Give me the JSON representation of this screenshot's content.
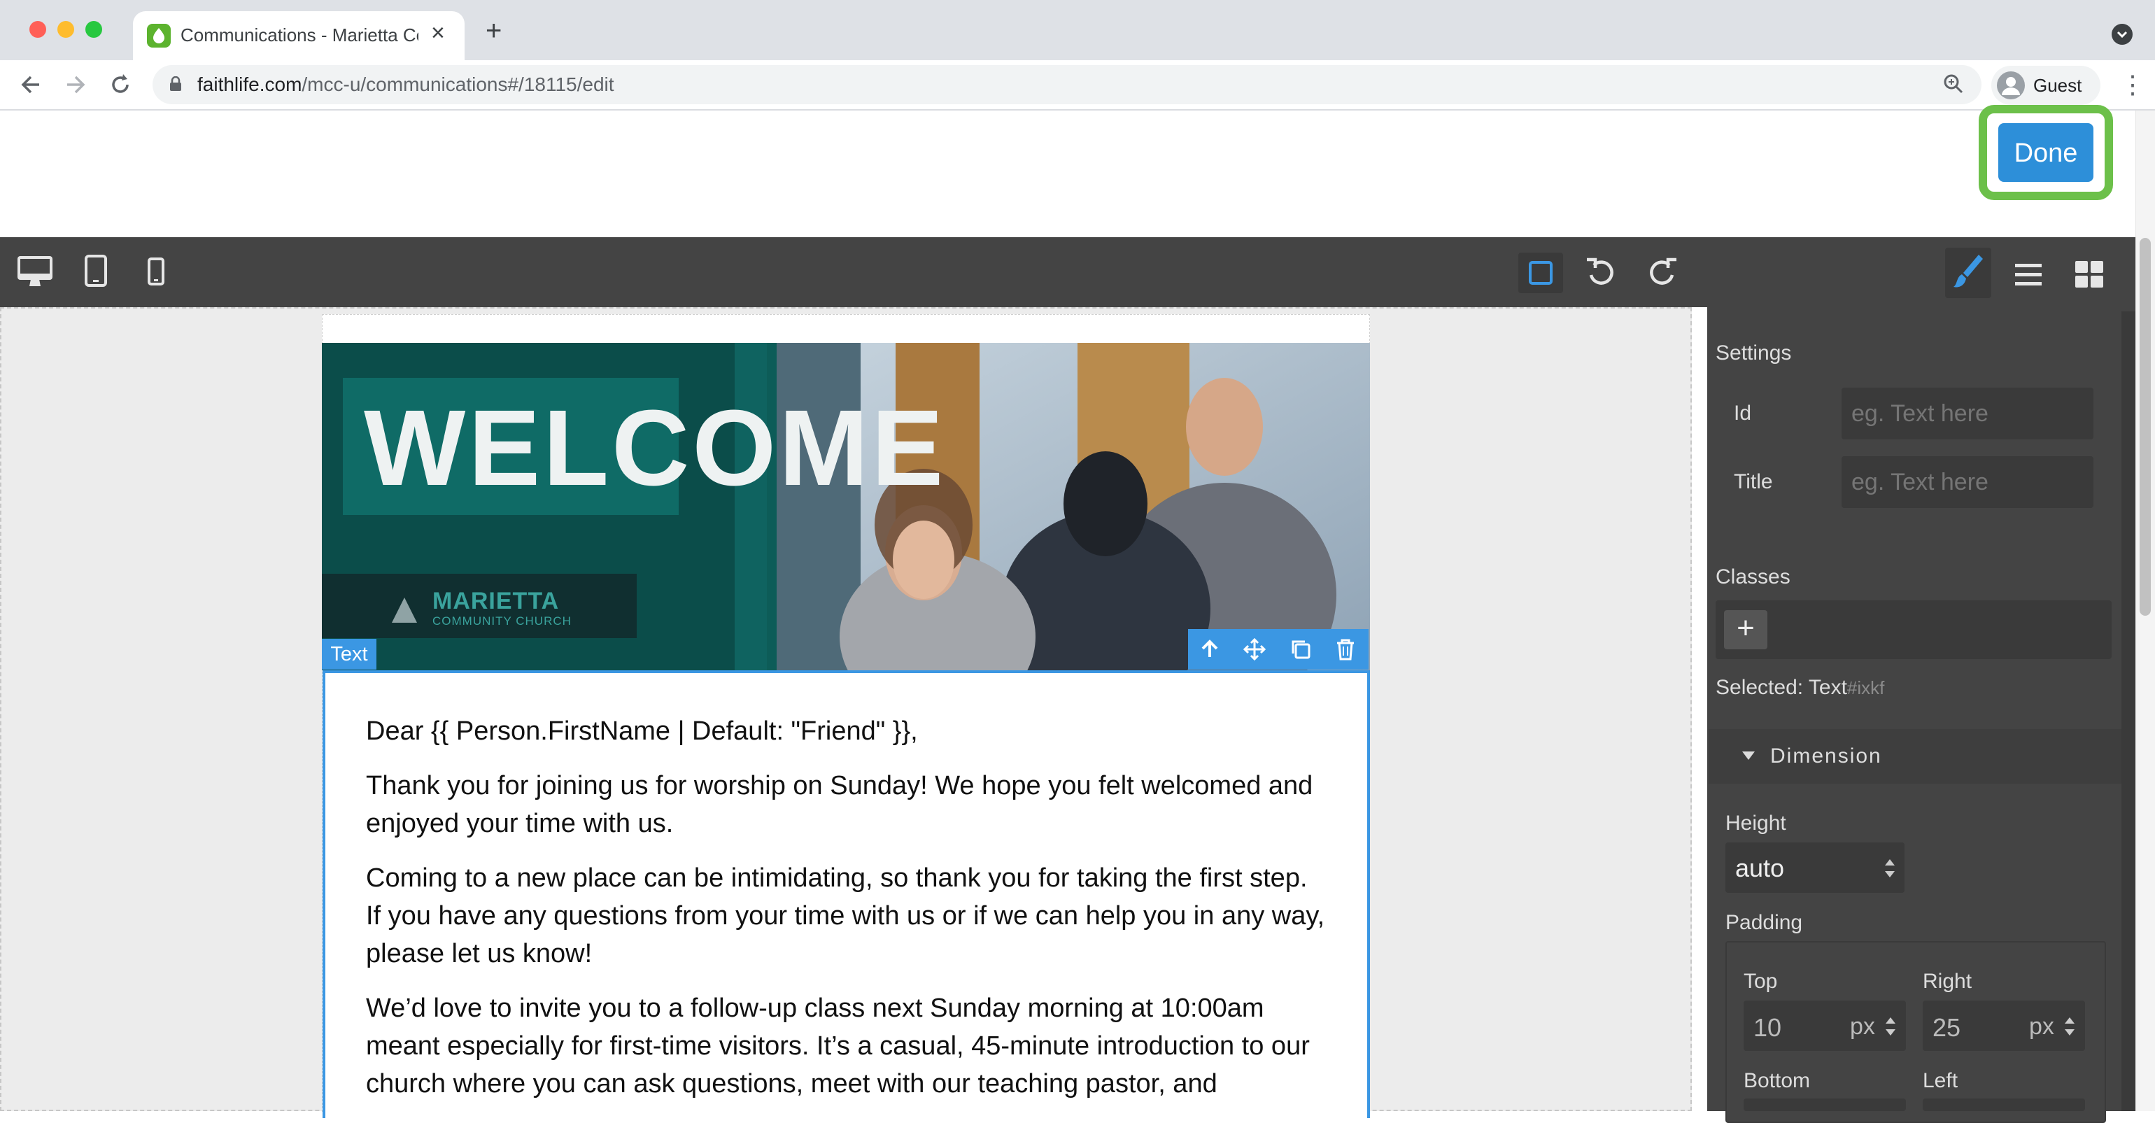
{
  "browser": {
    "tab_title": "Communications - Marietta Co",
    "tab_close": "×",
    "new_tab": "+",
    "url_domain": "faithlife.com",
    "url_path": "/mcc-u/communications#/18115/edit",
    "profile_label": "Guest",
    "menu": "⋮"
  },
  "header": {
    "done_label": "Done"
  },
  "email": {
    "hero_heading": "WELCOME",
    "hero_logo_name": "MARIETTA",
    "hero_logo_sub": "COMMUNITY CHURCH",
    "selected_badge": "Text",
    "paragraphs": [
      "Dear {{ Person.FirstName | Default: \"Friend\" }},",
      "Thank you for joining us for worship on Sunday! We hope you felt welcomed and enjoyed your time with us.",
      "Coming to a new place can be intimidating, so thank you for taking the first step. If you have any questions from your time with us or if we can help you in any way, please let us know!",
      "We’d love to invite you to a follow-up class next Sunday morning at 10:00am meant especially for first-time visitors. It’s a casual, 45-minute introduction to our church where you can ask questions, meet with our teaching pastor, and"
    ]
  },
  "panel": {
    "settings_title": "Settings",
    "id_label": "Id",
    "id_placeholder": "eg. Text here",
    "title_label": "Title",
    "title_placeholder": "eg. Text here",
    "classes_title": "Classes",
    "plus": "+",
    "selected_label": "Selected:",
    "selected_name": "Text",
    "selected_id": "#ixkf",
    "dimension_title": "Dimension",
    "height_label": "Height",
    "height_value": "auto",
    "padding_label": "Padding",
    "top_label": "Top",
    "top_value": "10",
    "top_unit": "px",
    "right_label": "Right",
    "right_value": "25",
    "right_unit": "px",
    "bottom_label": "Bottom",
    "left_label": "Left"
  },
  "colors": {
    "accent": "#3b97e3",
    "done": "#2d8fd9",
    "highlight": "#6cc04a",
    "hero_teal": "#0a5b57"
  }
}
